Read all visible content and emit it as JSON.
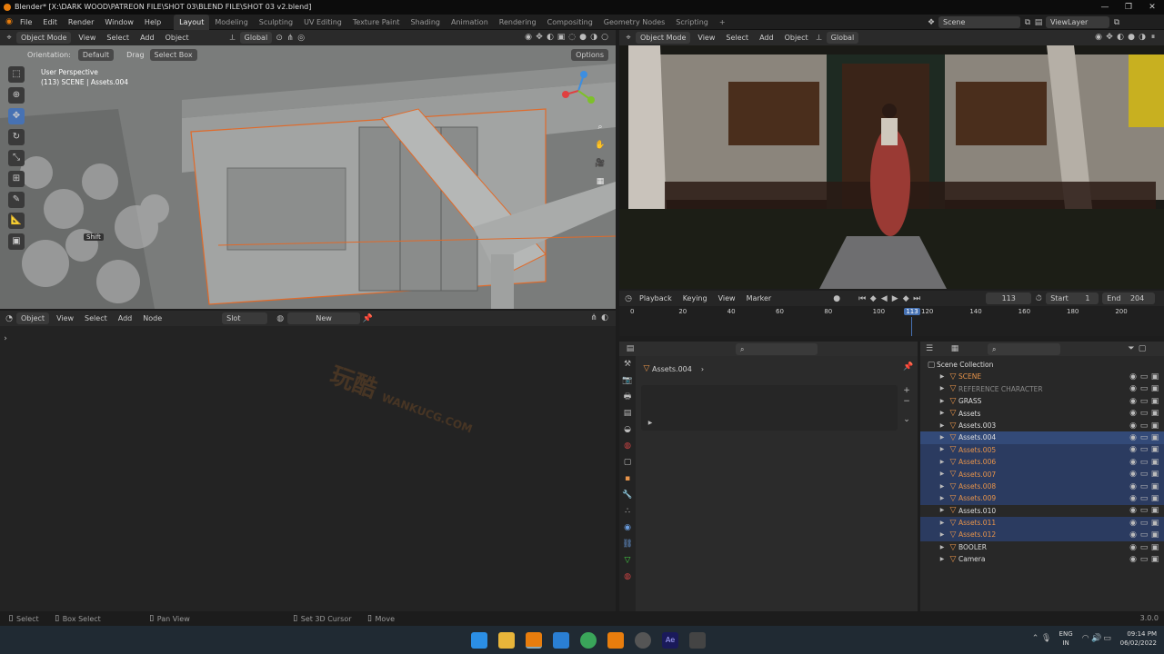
{
  "window": {
    "title": "Blender* [X:\\DARK WOOD\\PATREON FILE\\SHOT 03\\BLEND FILE\\SHOT 03 v2.blend]",
    "controls": [
      "—",
      "❐",
      "✕"
    ]
  },
  "menu": [
    "File",
    "Edit",
    "Render",
    "Window",
    "Help"
  ],
  "workspaces": [
    "Layout",
    "Modeling",
    "Sculpting",
    "UV Editing",
    "Texture Paint",
    "Shading",
    "Animation",
    "Rendering",
    "Compositing",
    "Geometry Nodes",
    "Scripting"
  ],
  "active_workspace": "Layout",
  "scene": {
    "name": "Scene",
    "view_layer": "ViewLayer"
  },
  "viewport": {
    "mode": "Object Mode",
    "menus": [
      "View",
      "Select",
      "Add",
      "Object"
    ],
    "transform": "Global",
    "orientation_label": "Orientation:",
    "orientation_value": "Default",
    "drag_label": "Drag",
    "drag_value": "Select Box",
    "options": "Options",
    "overlay_line1": "User Perspective",
    "overlay_line2": "(113) SCENE | Assets.004",
    "shift_hint": "Shift"
  },
  "render_view": {
    "mode": "Object Mode",
    "menus": [
      "View",
      "Select",
      "Add",
      "Object"
    ],
    "transform": "Global"
  },
  "timeline": {
    "menus": [
      "Playback",
      "Keying",
      "View",
      "Marker"
    ],
    "current_frame": "113",
    "start_label": "Start",
    "start": "1",
    "end_label": "End",
    "end": "204",
    "ticks": [
      "0",
      "20",
      "40",
      "60",
      "80",
      "100",
      "113",
      "120",
      "140",
      "160",
      "180",
      "200"
    ]
  },
  "node_editor": {
    "mode": "Object",
    "menus": [
      "View",
      "Select",
      "Add",
      "Node"
    ],
    "slot": "Slot",
    "new_button": "New"
  },
  "properties": {
    "breadcrumb": "Assets.004"
  },
  "outliner": {
    "root": "Scene Collection",
    "items": [
      {
        "name": "SCENE",
        "color": "orange",
        "state": "normal"
      },
      {
        "name": "REFERENCE CHARACTER",
        "color": "grey",
        "state": "normal"
      },
      {
        "name": "GRASS",
        "color": "normal",
        "state": "normal"
      },
      {
        "name": "Assets",
        "color": "normal",
        "state": "normal"
      },
      {
        "name": "Assets.003",
        "color": "normal",
        "state": "normal"
      },
      {
        "name": "Assets.004",
        "color": "normal",
        "state": "active"
      },
      {
        "name": "Assets.005",
        "color": "orange",
        "state": "selected"
      },
      {
        "name": "Assets.006",
        "color": "orange",
        "state": "selected"
      },
      {
        "name": "Assets.007",
        "color": "orange",
        "state": "selected"
      },
      {
        "name": "Assets.008",
        "color": "orange",
        "state": "selected"
      },
      {
        "name": "Assets.009",
        "color": "orange",
        "state": "selected"
      },
      {
        "name": "Assets.010",
        "color": "normal",
        "state": "normal"
      },
      {
        "name": "Assets.011",
        "color": "orange",
        "state": "selected"
      },
      {
        "name": "Assets.012",
        "color": "orange",
        "state": "selected"
      },
      {
        "name": "BOOLER",
        "color": "normal",
        "state": "normal"
      },
      {
        "name": "Camera",
        "color": "normal",
        "state": "normal"
      }
    ]
  },
  "statusbar": {
    "items": [
      "Select",
      "Box Select",
      "Pan View",
      "Set 3D Cursor",
      "Move"
    ],
    "version": "3.0.0"
  },
  "taskbar": {
    "lang_line1": "ENG",
    "lang_line2": "IN",
    "time": "09:14 PM",
    "date": "06/02/2022"
  },
  "colors": {
    "accent": "#4772b3",
    "selection": "#e8944a",
    "outliner_selected": "#334a78"
  },
  "watermark": {
    "text": "玩酷",
    "sub": "WANKUCG.COM"
  }
}
